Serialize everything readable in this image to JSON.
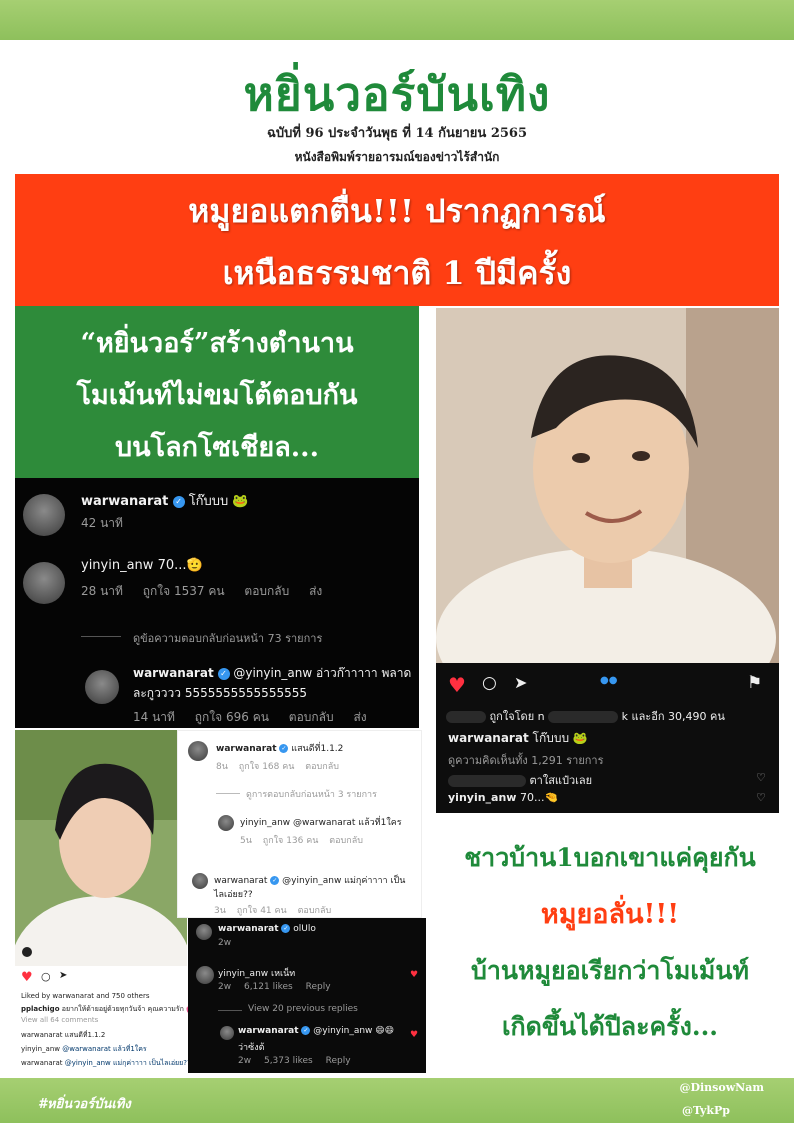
{
  "masthead": {
    "title": "หยิ่นวอร์บันเทิง",
    "issue": "ฉบับที่ 96 ประจำวันพุธ ที่ 14 กันยายน 2565",
    "tagline": "หนังสือพิมพ์รายอารมณ์ของข่าวไร้สำนัก"
  },
  "headline": {
    "line1": "หมูยอแตกตื่น!!! ปรากฏการณ์",
    "line2": "เหนือธรรมชาติ 1 ปีมีครั้ง"
  },
  "subhead": {
    "line1": "“หยิ่นวอร์”สร้างตำนาน",
    "line2": "โมเม้นท์ไม่ขมโต้ตอบกัน",
    "line3": "บนโลกโซเชียล..."
  },
  "ig_post": {
    "likes_text": "k และอีก 30,490 คน",
    "likes_prefix": "ถูกใจโดย n",
    "owner": "warwanarat",
    "caption": "โก๊บบบ 🐸",
    "view_comments": "ดูความคิดเห็นทั้ง 1,291 รายการ",
    "comment1_text": "ตาใสแป๋วเลย",
    "comment2_user": "yinyin_anw",
    "comment2_text": "70...🤏"
  },
  "comments_main": {
    "c1_user": "warwanarat",
    "c1_text": "โก๊บบบ 🐸",
    "c1_time": "42 นาที",
    "c2_user": "yinyin_anw",
    "c2_text": "70...🫡",
    "c2_time": "28 นาที",
    "c2_likes": "ถูกใจ 1537 คน",
    "c2_reply": "ตอบกลับ",
    "c2_send": "ส่ง",
    "view_prev": "ดูข้อความตอบกลับก่อนหน้า 73 รายการ",
    "c3_user": "warwanarat",
    "c3_text": "@yinyin_anw อ่าวก๊าาาาา พลาด",
    "c3_text2": "ละกูวววว 5555555555555555",
    "c3_time": "14 นาที",
    "c3_likes": "ถูกใจ 696 คน",
    "c3_reply": "ตอบกลับ",
    "c3_send": "ส่ง"
  },
  "light_comments": {
    "c1_user": "warwanarat",
    "c1_text": "แสนดีที่1.1.2",
    "c1_meta_time": "8น",
    "c1_meta_likes": "ถูกใจ 168 คน",
    "c1_meta_reply": "ตอบกลับ",
    "view_prev": "ดูการตอบกลับก่อนหน้า 3 รายการ",
    "c2_user": "yinyin_anw",
    "c2_text": "@warwanarat แล้วที่1ใคร",
    "c2_meta_time": "5น",
    "c2_meta_likes": "ถูกใจ 136 คน",
    "c2_meta_reply": "ตอบกลับ",
    "c3_user": "warwanarat",
    "c3_text": "@yinyin_anw แม่กุค่าาาา เป็น",
    "c3_text2": "ไลเอ่ยย??",
    "c3_meta_time": "3น",
    "c3_meta_likes": "ถูกใจ 41 คน",
    "c3_meta_reply": "ตอบกลับ"
  },
  "dark_comments2": {
    "c1_user": "warwanarat",
    "c1_text": "olUlo",
    "c1_time": "2w",
    "c2_user": "yinyin_anw",
    "c2_text": "เหเน็ท",
    "c2_time": "2w",
    "c2_likes": "6,121 likes",
    "c2_reply": "Reply",
    "view_prev": "View 20 previous replies",
    "c3_user": "warwanarat",
    "c3_text": "@yinyin_anw 😄😄",
    "c3_text2": "ว่าซ้งต้",
    "c3_time": "2w",
    "c3_likes": "5,373 likes",
    "c3_reply": "Reply"
  },
  "ig_white": {
    "liked_by": "Liked by warwanarat and 750 others",
    "caption_user": "pplachigo",
    "caption": "อยากให้ด้ายอยู่ด้วยทุกวันจ้า คุณความรัก 💕",
    "view_all": "View all 64 comments",
    "c1": "warwanarat แสนดีที่1.1.2",
    "c2_user": "yinyin_anw",
    "c2": "@warwanarat แล้วที่1ใคร",
    "c3_user": "warwanarat",
    "c3": "@yinyin_anw แม่กุค่าาาา เป็นไลเอ่ยย??"
  },
  "right_copy": {
    "line1": "ชาวบ้าน1บอกเขาแค่คุยกัน",
    "line2": "หมูยอลั่น!!!",
    "line3": "บ้านหมูยอเรียกว่าโมเม้นท์",
    "line4": "เกิดขึ้นได้ปีละครั้ง..."
  },
  "footer": {
    "hashtag": "#หยิ่นวอร์บันเทิง",
    "credit1": "@DinsowNam",
    "credit2": "@TykPp"
  },
  "colors": {
    "green": "#1f8a3a",
    "red": "#ff3e12",
    "bar_green": "#8ec05c"
  }
}
